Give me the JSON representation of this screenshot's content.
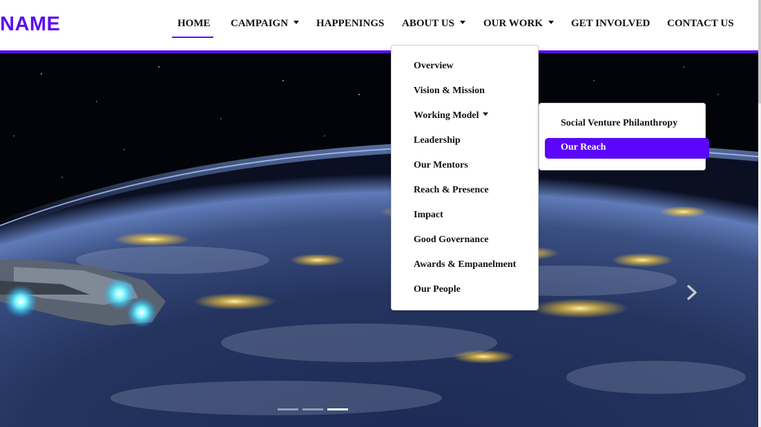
{
  "brand": {
    "name": "NAME",
    "color": "#5b10f0"
  },
  "nav": {
    "items": [
      {
        "label": "HOME",
        "active": true
      },
      {
        "label": "CAMPAIGN",
        "has_dropdown": true
      },
      {
        "label": "HAPPENINGS"
      },
      {
        "label": "ABOUT US",
        "has_dropdown": true
      },
      {
        "label": "OUR WORK",
        "has_dropdown": true
      },
      {
        "label": "GET INVOLVED"
      },
      {
        "label": "CONTACT US"
      }
    ]
  },
  "about_dropdown": {
    "items": [
      {
        "label": "Overview"
      },
      {
        "label": "Vision & Mission"
      },
      {
        "label": "Working Model",
        "has_submenu": true
      },
      {
        "label": "Leadership"
      },
      {
        "label": "Our Mentors"
      },
      {
        "label": "Reach & Presence"
      },
      {
        "label": "Impact"
      },
      {
        "label": "Good Governance"
      },
      {
        "label": "Awards & Empanelment"
      },
      {
        "label": "Our People"
      }
    ]
  },
  "working_model_submenu": {
    "items": [
      {
        "label": "Social Venture Philanthropy"
      },
      {
        "label": "Our Reach",
        "active": true
      }
    ]
  },
  "carousel": {
    "image": "space-earth-spaceship",
    "slides": 3,
    "active_slide": 3,
    "next_icon": "chevron-right-icon"
  },
  "colors": {
    "accent": "#5b10f0",
    "active_item_bg": "#5b06fb"
  }
}
